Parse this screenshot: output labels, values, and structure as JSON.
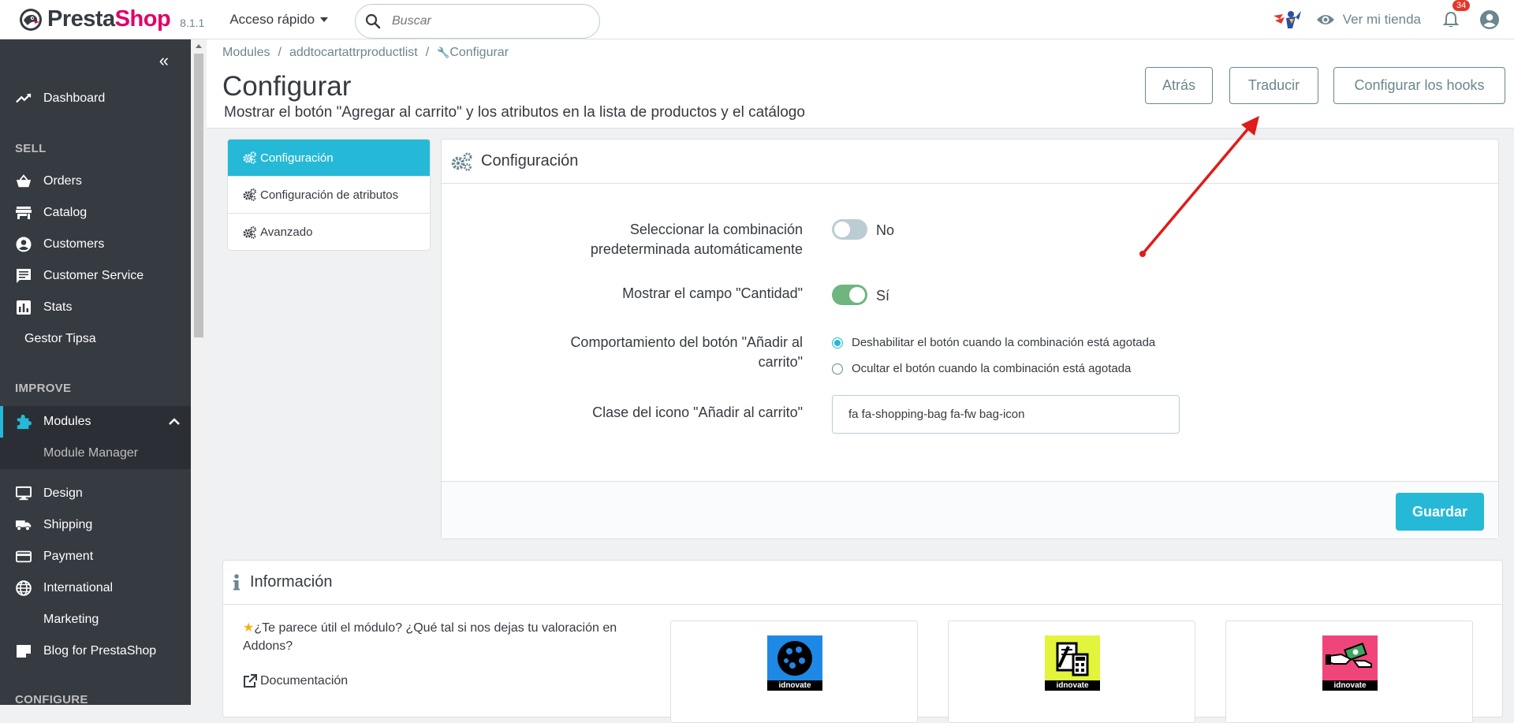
{
  "topbar": {
    "brand_prefix": "Presta",
    "brand_suffix": "Shop",
    "version": "8.1.1",
    "quick_access": "Acceso rápido",
    "search_placeholder": "Buscar",
    "view_shop": "Ver mi tienda",
    "notifications_count": "34"
  },
  "sidebar": {
    "items": [
      {
        "label": "Dashboard",
        "icon": "trending-up-icon"
      },
      {
        "section": "SELL"
      },
      {
        "label": "Orders",
        "icon": "shopping-basket-icon"
      },
      {
        "label": "Catalog",
        "icon": "store-icon"
      },
      {
        "label": "Customers",
        "icon": "account-circle-icon"
      },
      {
        "label": "Customer Service",
        "icon": "chat-icon"
      },
      {
        "label": "Stats",
        "icon": "bar-chart-icon"
      },
      {
        "label": "Gestor Tipsa"
      },
      {
        "section": "IMPROVE"
      },
      {
        "label": "Modules",
        "icon": "puzzle-icon"
      },
      {
        "label": "Module Manager"
      },
      {
        "label": "Design",
        "icon": "desktop-icon"
      },
      {
        "label": "Shipping",
        "icon": "truck-icon"
      },
      {
        "label": "Payment",
        "icon": "credit-card-icon"
      },
      {
        "label": "International",
        "icon": "globe-icon"
      },
      {
        "label": "Marketing"
      },
      {
        "label": "Blog for PrestaShop",
        "icon": "note-icon"
      },
      {
        "section": "CONFIGURE"
      }
    ]
  },
  "header": {
    "breadcrumb": [
      "Modules",
      "addtocartattrproductlist",
      "Configurar"
    ],
    "title": "Configurar",
    "subtitle": "Mostrar el botón \"Agregar al carrito\" y los atributos en la lista de productos y el catálogo",
    "buttons": [
      "Atrás",
      "Traducir",
      "Configurar los hooks"
    ]
  },
  "tabs": [
    "Configuración",
    "Configuración de atributos",
    "Avanzado"
  ],
  "panel": {
    "title": "Configuración",
    "fields": {
      "auto_combination_label": "Seleccionar la combinación predeterminada automáticamente",
      "auto_combination_value": "No",
      "show_quantity_label": "Mostrar el campo \"Cantidad\"",
      "show_quantity_value": "Sí",
      "button_behavior_label": "Comportamiento del botón \"Añadir al carrito\"",
      "button_behavior_options": [
        "Deshabilitar el botón cuando la combinación está agotada",
        "Ocultar el botón cuando la combinación está agotada"
      ],
      "icon_class_label": "Clase del icono \"Añadir al carrito\"",
      "icon_class_value": "fa fa-shopping-bag fa-fw bag-icon"
    },
    "save": "Guardar"
  },
  "info": {
    "title": "Información",
    "rate_text": "¿Te parece útil el módulo? ¿Qué tal si nos dejas tu valoración en Addons?",
    "docs": "Documentación",
    "card_label": "idnovate",
    "card_colors": [
      "#1e88e5",
      "#e2f53c",
      "#f0457a"
    ]
  },
  "colors": {
    "accent": "#25b9d7",
    "sidebar": "#363a41",
    "switch_on": "#70b580",
    "arrow": "#e01b1b"
  }
}
